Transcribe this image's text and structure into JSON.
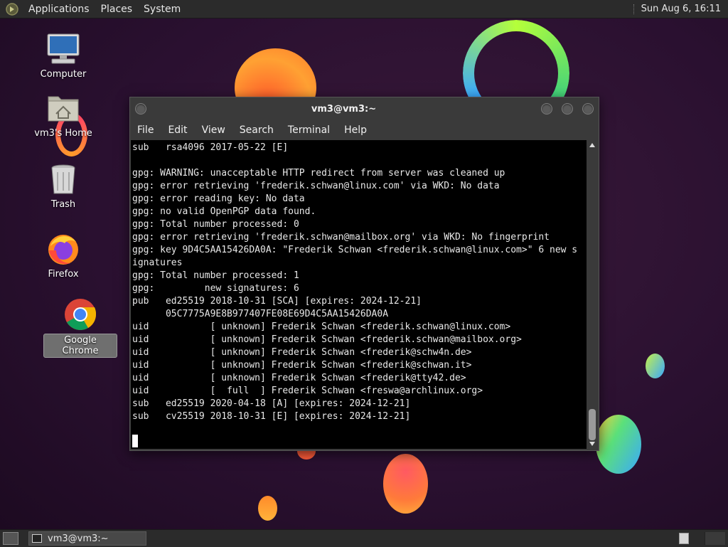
{
  "top_panel": {
    "menus": [
      "Applications",
      "Places",
      "System"
    ],
    "clock": "Sun Aug  6, 16:11"
  },
  "desktop_icons": [
    {
      "label": "Computer",
      "icon": "computer-icon"
    },
    {
      "label": "vm3's Home",
      "icon": "home-folder-icon"
    },
    {
      "label": "Trash",
      "icon": "trash-icon"
    },
    {
      "label": "Firefox",
      "icon": "firefox-icon"
    },
    {
      "label": "Google Chrome",
      "icon": "chrome-icon",
      "selected": true
    }
  ],
  "window": {
    "title": "vm3@vm3:~",
    "menu": [
      "File",
      "Edit",
      "View",
      "Search",
      "Terminal",
      "Help"
    ]
  },
  "terminal": {
    "lines": [
      "sub   rsa4096 2017-05-22 [E]",
      "",
      "gpg: WARNING: unacceptable HTTP redirect from server was cleaned up",
      "gpg: error retrieving 'frederik.schwan@linux.com' via WKD: No data",
      "gpg: error reading key: No data",
      "gpg: no valid OpenPGP data found.",
      "gpg: Total number processed: 0",
      "gpg: error retrieving 'frederik.schwan@mailbox.org' via WKD: No fingerprint",
      "gpg: key 9D4C5AA15426DA0A: \"Frederik Schwan <frederik.schwan@linux.com>\" 6 new s",
      "ignatures",
      "gpg: Total number processed: 1",
      "gpg:         new signatures: 6",
      "pub   ed25519 2018-10-31 [SCA] [expires: 2024-12-21]",
      "      05C7775A9E8B977407FE08E69D4C5AA15426DA0A",
      "uid           [ unknown] Frederik Schwan <frederik.schwan@linux.com>",
      "uid           [ unknown] Frederik Schwan <frederik.schwan@mailbox.org>",
      "uid           [ unknown] Frederik Schwan <frederik@schw4n.de>",
      "uid           [ unknown] Frederik Schwan <frederik@schwan.it>",
      "uid           [ unknown] Frederik Schwan <frederik@tty42.de>",
      "uid           [  full  ] Frederik Schwan <freswa@archlinux.org>",
      "sub   ed25519 2020-04-18 [A] [expires: 2024-12-21]",
      "sub   cv25519 2018-10-31 [E] [expires: 2024-12-21]",
      "",
      ""
    ]
  },
  "taskbar": {
    "task_label": "vm3@vm3:~"
  }
}
